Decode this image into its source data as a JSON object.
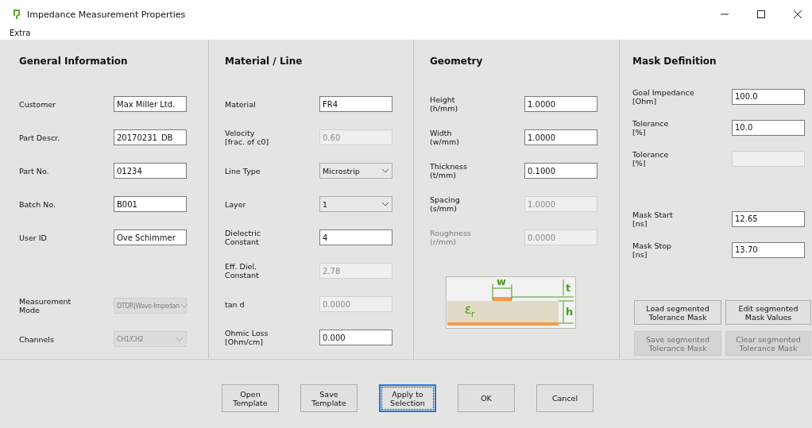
{
  "window": {
    "title": "Impedance Measurement Properties"
  },
  "menu": [
    {
      "label": "Extra"
    }
  ],
  "sections": [
    {
      "title": "General Information",
      "groups": [
        [
          {
            "label": "Customer",
            "kind": "text",
            "value": "Max Miller Ltd.",
            "disabled": false
          },
          {
            "label": "Part Descr.",
            "kind": "text",
            "value": "20170231_DB",
            "disabled": false
          },
          {
            "label": "Part No.",
            "kind": "text",
            "value": "01234",
            "disabled": false
          },
          {
            "label": "Batch No.",
            "kind": "text",
            "value": "B001",
            "disabled": false
          },
          {
            "label": "User ID",
            "kind": "text",
            "value": "Ove Schimmer",
            "disabled": false
          }
        ],
        [
          {
            "label": "Measurement\nMode",
            "kind": "dropdown",
            "value": "DTDR|Wave-Impedan",
            "disabled": true
          },
          {
            "label": "Channels",
            "kind": "dropdown",
            "value": "CH1/CH2",
            "disabled": true
          }
        ]
      ]
    },
    {
      "title": "Material / Line",
      "groups": [
        [
          {
            "label": "Material",
            "kind": "text",
            "value": "FR4",
            "disabled": false
          },
          {
            "label": "Velocity\n[frac. of c0]",
            "kind": "text",
            "value": "0.60",
            "disabled": true
          },
          {
            "label": "Line Type",
            "kind": "dropdown",
            "value": "Microstrip",
            "disabled": false
          },
          {
            "label": "Layer",
            "kind": "dropdown",
            "value": "1",
            "disabled": false
          },
          {
            "label": "Dielectric\nConstant",
            "kind": "text",
            "value": "4",
            "disabled": false
          },
          {
            "label": "Eff. Diel.\nConstant",
            "kind": "text",
            "value": "2.78",
            "disabled": true
          },
          {
            "label": "tan d",
            "kind": "text",
            "value": "0.0000",
            "disabled": true
          },
          {
            "label": "Ohmic Loss\n[Ohm/cm]",
            "kind": "text",
            "value": "0.000",
            "disabled": false
          }
        ]
      ]
    },
    {
      "title": "Geometry",
      "groups": [
        [
          {
            "label": "Height\n(h/mm)",
            "kind": "text",
            "value": "1.0000",
            "disabled": false
          },
          {
            "label": "Width\n(w/mm)",
            "kind": "text",
            "value": "1.0000",
            "disabled": false
          },
          {
            "label": "Thickness\n(t/mm)",
            "kind": "text",
            "value": "0.1000",
            "disabled": false
          },
          {
            "label": "Spacing\n(s/mm)",
            "kind": "text",
            "value": "1.0000",
            "disabled": true
          },
          {
            "label": "Roughness\n(r/mm)",
            "kind": "text",
            "value": "0.0000",
            "disabled": true,
            "label_disabled": true
          }
        ]
      ],
      "diagram": {
        "labels": [
          "w",
          "t",
          "ε$_{r}$",
          "h"
        ]
      }
    },
    {
      "title": "Mask Definition",
      "groups": [
        [
          {
            "label": "Goal Impedance\n[Ohm]",
            "kind": "text",
            "value": "100.0",
            "disabled": false
          },
          {
            "label": "Tolerance\n[%]",
            "kind": "text",
            "value": "10.0",
            "disabled": false
          },
          {
            "label": "Tolerance\n[%]",
            "kind": "text",
            "disabled": true
          }
        ],
        [
          {
            "label": "Mask Start\n[ns]",
            "kind": "text",
            "value": "12.65",
            "disabled": false
          },
          {
            "label": "Mask Stop\n[ns]",
            "kind": "text",
            "value": "13.70",
            "disabled": false
          }
        ]
      ],
      "buttons": [
        {
          "label": "Load segmented\nTolerance Mask",
          "disabled": false
        },
        {
          "label": "Edit segmented\nMask Values",
          "disabled": false
        },
        {
          "label": "Save segmented\nTolerance Mask",
          "disabled": true
        },
        {
          "label": "Clear segmented\nTolerance Mask",
          "disabled": true
        }
      ]
    }
  ],
  "buttons": [
    {
      "label": "Open\nTemplate",
      "focused": false
    },
    {
      "label": "Save\nTemplate",
      "focused": false
    },
    {
      "label": "Apply to\nSelection",
      "focused": true
    },
    {
      "label": "OK",
      "focused": false
    },
    {
      "label": "Cancel",
      "focused": false
    }
  ]
}
